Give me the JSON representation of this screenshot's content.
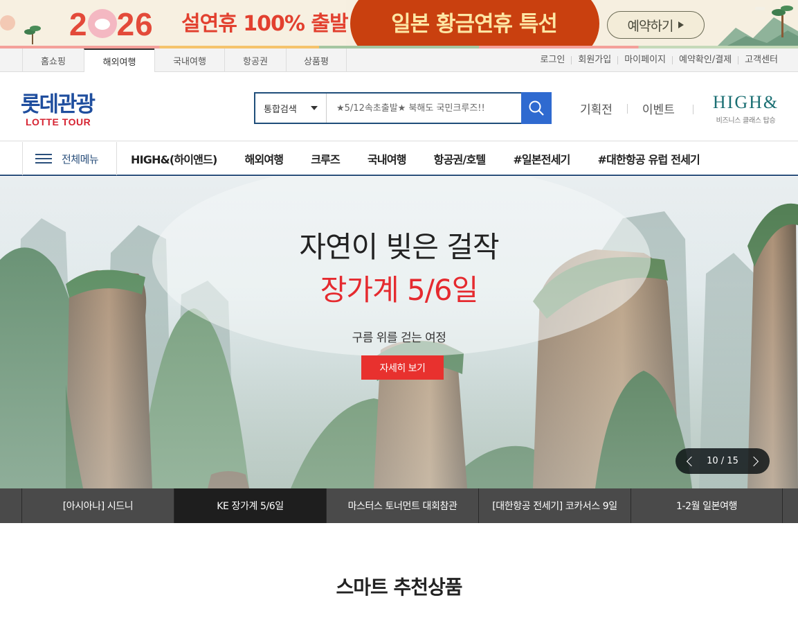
{
  "promo": {
    "year_prefix": "2",
    "year_suffix": "26",
    "sub": "설연휴 100% 출발",
    "highlight": "일본 황금연휴 특선",
    "button": "예약하기"
  },
  "util": {
    "tabs": [
      {
        "label": "홈쇼핑",
        "active": false,
        "width": 89
      },
      {
        "label": "해외여행",
        "active": true,
        "width": 102
      },
      {
        "label": "국내여행",
        "active": false,
        "width": 101
      },
      {
        "label": "항공권",
        "active": false,
        "width": 89
      },
      {
        "label": "상품평",
        "active": false,
        "width": 88
      }
    ],
    "links": [
      "로그인",
      "회원가입",
      "마이페이지",
      "예약확인/결제",
      "고객센터"
    ]
  },
  "header": {
    "logo_kr": "롯데관광",
    "logo_en": "LOTTE TOUR",
    "search_scope": "통합검색",
    "search_placeholder": "★5/12속초출발★ 북해도 국민크루즈!!",
    "links": [
      "기획전",
      "이벤트"
    ],
    "high_brand": "HIGH&",
    "high_tag": "비즈니스 클래스 탑승"
  },
  "nav": {
    "all_menu": "전체메뉴",
    "items": [
      "HIGH&(하이앤드)",
      "해외여행",
      "크루즈",
      "국내여행",
      "항공권/호텔",
      "#일본전세기",
      "#대한항공 유럽 전세기"
    ]
  },
  "hero": {
    "headline": "자연이 빚은 걸작",
    "subhead": "장가계 5/6일",
    "tagline": "구름 위를 걷는 여정",
    "cta": "자세히 보기",
    "pager": "10 / 15"
  },
  "slide_tabs": [
    {
      "label": "[아시아나] 시드니",
      "active": false
    },
    {
      "label": "KE 장가계 5/6일",
      "active": true
    },
    {
      "label": "마스터스 토너먼트 대회참관",
      "active": false
    },
    {
      "label": "[대한항공 전세기] 코카서스 9일",
      "active": false
    },
    {
      "label": "1-2월 일본여행",
      "active": false
    }
  ],
  "section": {
    "title": "스마트 추천상품"
  }
}
